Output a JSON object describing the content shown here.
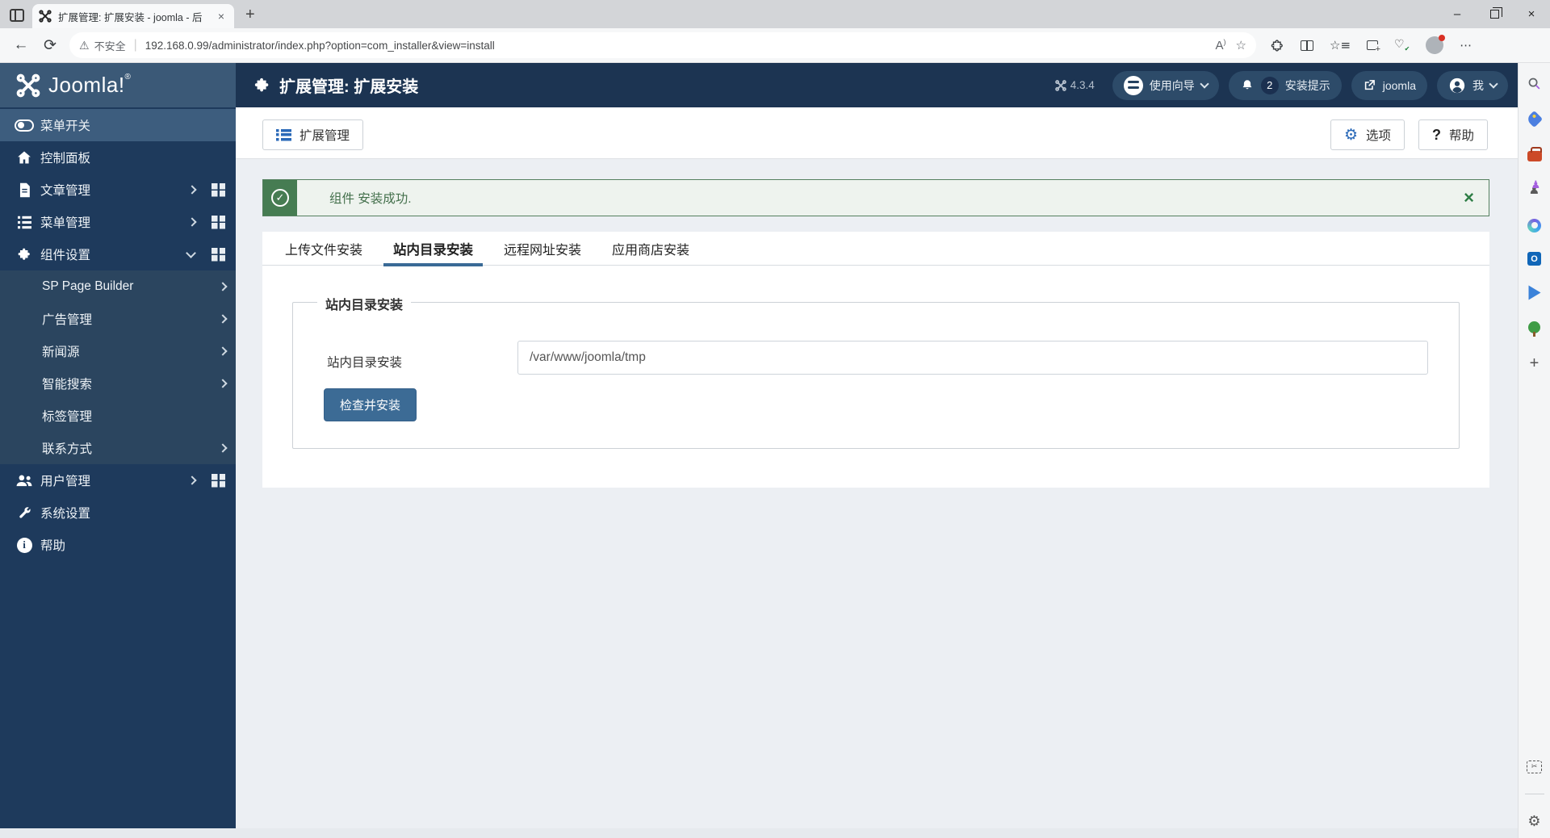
{
  "browser": {
    "tab_title": "扩展管理: 扩展安装 - joomla - 后",
    "tab_close": "×",
    "new_tab": "+",
    "back": "←",
    "refresh": "⟳",
    "security_label": "不安全",
    "url": "192.168.0.99/administrator/index.php?option=com_installer&view=install",
    "minimize": "–",
    "close": "×",
    "read_aloud": "A",
    "icons": [
      "workspaces-icon",
      "favicon-joomla",
      "read-aloud-icon",
      "favorite-star-icon",
      "extensions-icon",
      "split-screen-icon",
      "collections-icon",
      "web-capture-icon",
      "browser-essentials-icon",
      "profile-avatar",
      "settings-menu-icon"
    ]
  },
  "header": {
    "logo_text": "Joomla!",
    "logo_reg": "®",
    "page_title": "扩展管理: 扩展安装",
    "version": "4.3.4",
    "guide_button": "使用向导",
    "notifications_count": "2",
    "notices_button": "安装提示",
    "site_button": "joomla",
    "user_button": "我",
    "colors": {
      "header_bg": "#1c3452",
      "logo_bg": "#3b5977",
      "pill_bg": "#2d4b69"
    }
  },
  "sidebar": {
    "items": [
      {
        "label": "菜单开关",
        "icon": "menu-toggle-icon",
        "active": true
      },
      {
        "label": "控制面板",
        "icon": "home-icon"
      },
      {
        "label": "文章管理",
        "icon": "document-icon",
        "chevron": true,
        "grid": true
      },
      {
        "label": "菜单管理",
        "icon": "list-icon",
        "chevron": true,
        "grid": true
      },
      {
        "label": "组件设置",
        "icon": "puzzle-icon",
        "expanded": true,
        "grid": true
      }
    ],
    "submenu": [
      {
        "label": "SP Page Builder",
        "chevron": true
      },
      {
        "label": "广告管理",
        "chevron": true
      },
      {
        "label": "新闻源",
        "chevron": true
      },
      {
        "label": "智能搜索",
        "chevron": true
      },
      {
        "label": "标签管理",
        "chevron": false
      },
      {
        "label": "联系方式",
        "chevron": true
      }
    ],
    "bottom_items": [
      {
        "label": "用户管理",
        "icon": "users-icon",
        "chevron": true,
        "grid": true
      },
      {
        "label": "系统设置",
        "icon": "wrench-icon"
      },
      {
        "label": "帮助",
        "icon": "info-icon"
      }
    ],
    "colors": {
      "bg": "#1e3a5c",
      "active_bg": "#3d5d7e",
      "submenu_bg": "#2b455f"
    }
  },
  "toolbar": {
    "manage_button": "扩展管理",
    "options_button": "选项",
    "help_button": "帮助"
  },
  "alert": {
    "message": "组件 安装成功.",
    "close": "×",
    "colors": {
      "badge_bg": "#467c52",
      "body_bg": "#eef3ee",
      "border": "#55805f",
      "text": "#44704c"
    }
  },
  "tabs": {
    "items": [
      "上传文件安装",
      "站内目录安装",
      "远程网址安装",
      "应用商店安装"
    ],
    "active_index": 1,
    "active_color": "#3a6a96"
  },
  "form": {
    "legend": "站内目录安装",
    "field_label": "站内目录安装",
    "field_value": "/var/www/joomla/tmp",
    "submit_label": "检查并安装",
    "submit_color": "#3c6b95"
  },
  "edge_sidebar": {
    "icons": [
      "search-icon",
      "shopping-icon",
      "tools-icon",
      "games-icon",
      "copilot-icon",
      "outlook-icon",
      "drop-icon",
      "tree-planting-icon",
      "add-icon",
      "screenshot-icon",
      "settings-gear-icon"
    ],
    "add_label": "+"
  }
}
